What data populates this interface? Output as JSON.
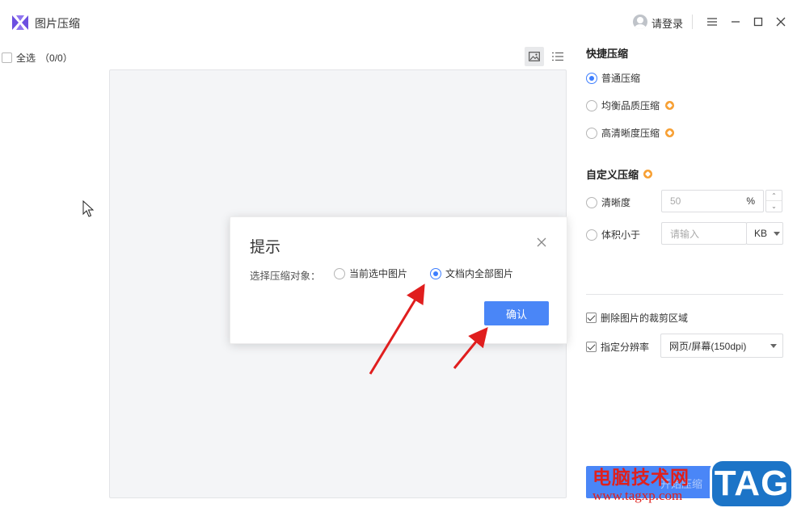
{
  "app": {
    "title": "图片压缩"
  },
  "header": {
    "login_label": "请登录"
  },
  "list": {
    "select_all_label": "全选",
    "count": "（0/0）"
  },
  "quick": {
    "title": "快捷压缩",
    "options": [
      "普通压缩",
      "均衡品质压缩",
      "高清晰度压缩"
    ],
    "selected": "普通压缩"
  },
  "custom": {
    "title": "自定义压缩",
    "clarity_label": "清晰度",
    "clarity_value": "50",
    "clarity_unit": "%",
    "size_label": "体积小于",
    "size_placeholder": "请输入",
    "size_unit": "KB"
  },
  "options": {
    "crop_label": "删除图片的裁剪区域",
    "crop_checked": true,
    "dpi_label": "指定分辨率",
    "dpi_checked": true,
    "dpi_value": "网页/屏幕(150dpi)"
  },
  "start_button": {
    "label": "开始压缩"
  },
  "dialog": {
    "title": "提示",
    "prompt": "选择压缩对象：",
    "option_current": "当前选中图片",
    "option_all": "文档内全部图片",
    "selected": "文档内全部图片",
    "confirm_label": "确认"
  },
  "watermark": {
    "text": "电脑技术网",
    "url": "www.tagxp.com",
    "tag": "TAG"
  },
  "colors": {
    "accent": "#4a86f7",
    "radio_on": "#3d7eff",
    "vip": "#f7a034",
    "arrow": "#e01e1e",
    "watermark_red": "#e0201c",
    "watermark_blue": "#1c74c7"
  }
}
